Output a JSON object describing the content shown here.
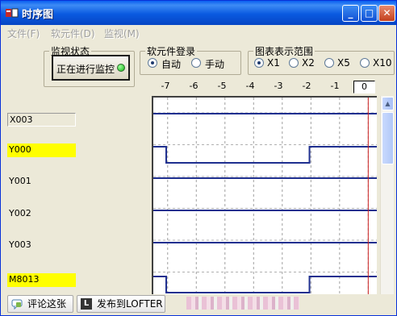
{
  "window": {
    "title": "时序图",
    "min_glyph": "_",
    "max_glyph": "□",
    "close_glyph": "✕"
  },
  "menu": [
    {
      "label": "文件(F)"
    },
    {
      "label": "软元件(D)"
    },
    {
      "label": "监视(M)"
    }
  ],
  "monitor_status": {
    "group_title": "监视状态",
    "button_label": "正在进行监控",
    "led_color": "#22CC22"
  },
  "device_register": {
    "group_title": "软元件登录",
    "options": [
      {
        "label": "自动",
        "selected": true
      },
      {
        "label": "手动",
        "selected": false
      }
    ]
  },
  "chart_range": {
    "group_title": "图表表示范围",
    "options": [
      {
        "label": "X1",
        "selected": true
      },
      {
        "label": "X2",
        "selected": false
      },
      {
        "label": "X5",
        "selected": false
      },
      {
        "label": "X10",
        "selected": false
      }
    ]
  },
  "timeline": {
    "ticks": [
      "-7",
      "-6",
      "-5",
      "-4",
      "-3",
      "-2",
      "-1"
    ],
    "current": "0"
  },
  "signals": [
    {
      "name": "X003",
      "highlight": false,
      "boxed": true
    },
    {
      "name": "Y000",
      "highlight": true,
      "boxed": false
    },
    {
      "name": "Y001",
      "highlight": false,
      "boxed": false
    },
    {
      "name": "Y002",
      "highlight": false,
      "boxed": false
    },
    {
      "name": "Y003",
      "highlight": false,
      "boxed": false
    },
    {
      "name": "M8013",
      "highlight": true,
      "boxed": false
    }
  ],
  "chart_data": {
    "type": "timing",
    "x_range": [
      -7.5,
      0.3
    ],
    "series": [
      {
        "name": "X003",
        "segments": [
          [
            -7.5,
            0.3,
            1
          ]
        ]
      },
      {
        "name": "Y000",
        "segments": [
          [
            -7.5,
            -7.05,
            1
          ],
          [
            -7.05,
            -2.05,
            0
          ],
          [
            -2.05,
            0.3,
            1
          ]
        ]
      },
      {
        "name": "Y001",
        "segments": [
          [
            -7.5,
            0.3,
            1
          ]
        ]
      },
      {
        "name": "Y002",
        "segments": [
          [
            -7.5,
            0.3,
            1
          ]
        ]
      },
      {
        "name": "Y003",
        "segments": [
          [
            -7.5,
            0.3,
            1
          ]
        ]
      },
      {
        "name": "M8013",
        "segments": [
          [
            -7.5,
            -7.05,
            1
          ],
          [
            -7.05,
            -2.05,
            0
          ],
          [
            -2.05,
            0.3,
            1
          ]
        ]
      }
    ],
    "cursor_x": 0
  },
  "colors": {
    "trace": "#1F2F8F",
    "cursor": "#CC2222",
    "highlight": "#FFFF00"
  },
  "footer": {
    "comment_button": "评论这张",
    "publish_button": "发布到LOFTER",
    "publish_icon_letter": "L"
  }
}
